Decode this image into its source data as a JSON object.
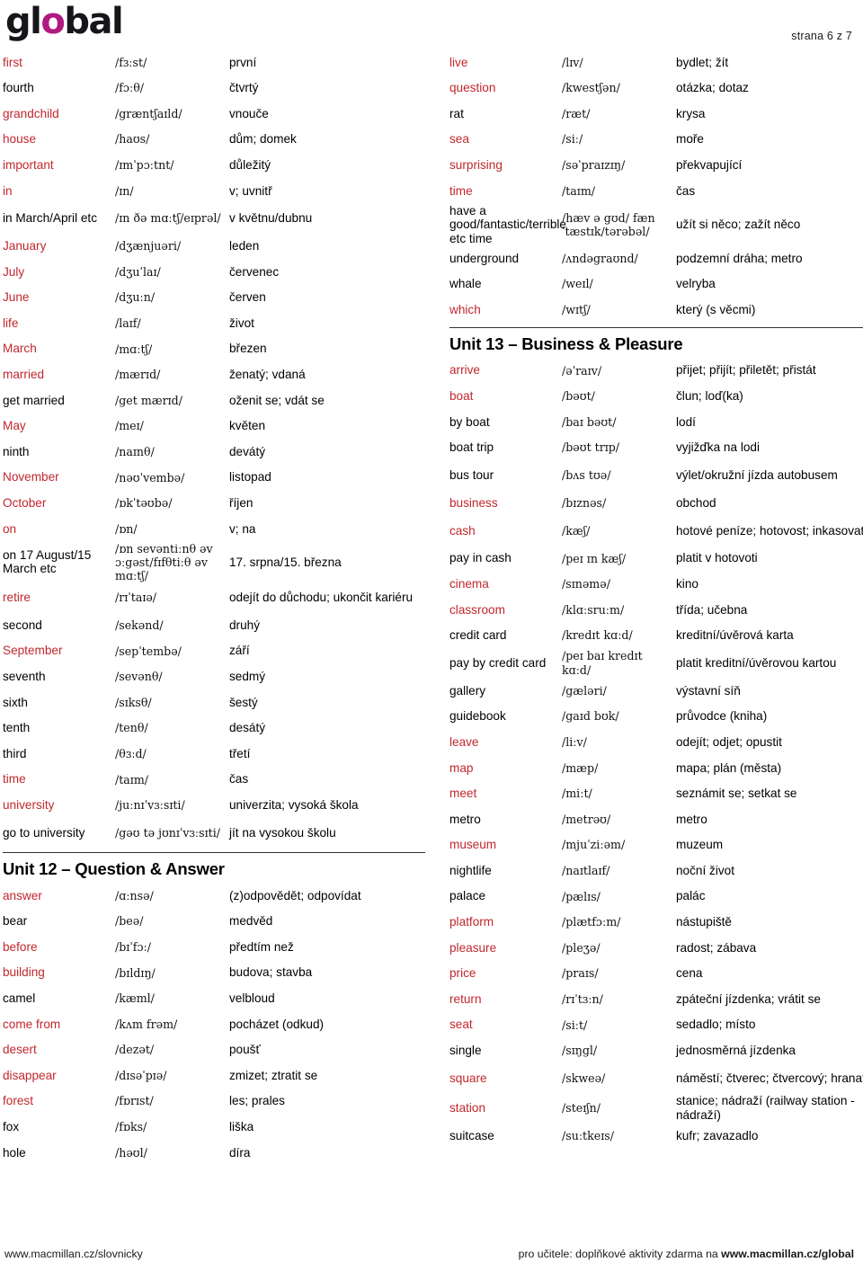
{
  "logo": {
    "part1": "gl",
    "part_o": "o",
    "part2": "bal"
  },
  "page_marker": "strana 6 z 7",
  "footer": {
    "left": "www.macmillan.cz/slovnicky",
    "right_prefix": "pro učitele: doplňkové aktivity zdarma na ",
    "right_bold": "www.macmillan.cz/global"
  },
  "colors": {
    "highlight": "#c1272d",
    "logo_accent": "#b0197f",
    "text": "#000000",
    "rule": "#333333"
  },
  "left_column": {
    "blocks": [
      {
        "type": "rows",
        "rows": [
          {
            "term": "first",
            "phon": "/fɜːst/",
            "cz": "první",
            "hl": true
          },
          {
            "term": "fourth",
            "phon": "/fɔːθ/",
            "cz": "čtvrtý",
            "hl": false
          },
          {
            "term": "grandchild",
            "phon": "/græntʃaɪld/",
            "cz": "vnouče",
            "hl": true
          },
          {
            "term": "house",
            "phon": "/haʊs/",
            "cz": "dům; domek",
            "hl": true
          },
          {
            "term": "important",
            "phon": "/ɪmˈpɔːtnt/",
            "cz": "důležitý",
            "hl": true
          },
          {
            "term": "in",
            "phon": "/ɪn/",
            "cz": "v; uvnitř",
            "hl": true
          },
          {
            "term": "in March/April etc",
            "phon": "/ɪn ðə mɑːtʃ/eɪprəl/",
            "cz": "v květnu/dubnu",
            "hl": false,
            "lines": 2
          },
          {
            "term": "January",
            "phon": "/dʒænjuəri/",
            "cz": "leden",
            "hl": true
          },
          {
            "term": "July",
            "phon": "/dʒuˈlaɪ/",
            "cz": "červenec",
            "hl": true
          },
          {
            "term": "June",
            "phon": "/dʒuːn/",
            "cz": "červen",
            "hl": true
          },
          {
            "term": "life",
            "phon": "/laɪf/",
            "cz": "život",
            "hl": true
          },
          {
            "term": "March",
            "phon": "/mɑːtʃ/",
            "cz": "březen",
            "hl": true
          },
          {
            "term": "married",
            "phon": "/mærɪd/",
            "cz": "ženatý; vdaná",
            "hl": true
          },
          {
            "term": "get married",
            "phon": "/get mærɪd/",
            "cz": "oženit se; vdát se",
            "hl": false
          },
          {
            "term": "May",
            "phon": "/meɪ/",
            "cz": "květen",
            "hl": true
          },
          {
            "term": "ninth",
            "phon": "/naɪnθ/",
            "cz": "devátý",
            "hl": false
          },
          {
            "term": "November",
            "phon": "/nəʊˈvembə/",
            "cz": "listopad",
            "hl": true
          },
          {
            "term": "October",
            "phon": "/ɒkˈtəʊbə/",
            "cz": "říjen",
            "hl": true
          },
          {
            "term": "on",
            "phon": "/ɒn/",
            "cz": "v; na",
            "hl": true
          },
          {
            "term": "on 17 August/15 March etc",
            "phon": "/ɒn sevəntiːnθ əv ɔːgəst/fɪfθtiːθ əv mɑːtʃ/",
            "cz": "17. srpna/15. března",
            "hl": false,
            "lines": 3
          },
          {
            "term": "retire",
            "phon": "/rɪˈtaɪə/",
            "cz": "odejít do důchodu; ukončit kariéru",
            "hl": true,
            "lines": 2
          },
          {
            "term": "second",
            "phon": "/sekənd/",
            "cz": "druhý",
            "hl": false
          },
          {
            "term": "September",
            "phon": "/sepˈtembə/",
            "cz": "září",
            "hl": true
          },
          {
            "term": "seventh",
            "phon": "/sevənθ/",
            "cz": "sedmý",
            "hl": false
          },
          {
            "term": "sixth",
            "phon": "/sɪksθ/",
            "cz": "šestý",
            "hl": false
          },
          {
            "term": "tenth",
            "phon": "/tenθ/",
            "cz": "desátý",
            "hl": false
          },
          {
            "term": "third",
            "phon": "/θɜːd/",
            "cz": "třetí",
            "hl": false
          },
          {
            "term": "time",
            "phon": "/taɪm/",
            "cz": "čas",
            "hl": true
          },
          {
            "term": "university",
            "phon": "/juːnɪˈvɜːsɪti/",
            "cz": "univerzita; vysoká škola",
            "hl": true
          },
          {
            "term": "go to university",
            "phon": "/gəʊ tə jʊnɪˈvɜːsɪti/",
            "cz": "jít na vysokou školu",
            "hl": false,
            "lines": 2
          }
        ]
      },
      {
        "type": "heading",
        "title": "Unit 12 – Question & Answer"
      },
      {
        "type": "rows",
        "rows": [
          {
            "term": "answer",
            "phon": "/ɑːnsə/",
            "cz": "(z)odpovědět; odpovídat",
            "hl": true
          },
          {
            "term": "bear",
            "phon": "/beə/",
            "cz": "medvěd",
            "hl": false
          },
          {
            "term": "before",
            "phon": "/bɪˈfɔː/",
            "cz": "předtím než",
            "hl": true
          },
          {
            "term": "building",
            "phon": "/bɪldɪŋ/",
            "cz": "budova; stavba",
            "hl": true
          },
          {
            "term": "camel",
            "phon": "/kæml/",
            "cz": "velbloud",
            "hl": false
          },
          {
            "term": "come from",
            "phon": "/kʌm frəm/",
            "cz": "pocházet (odkud)",
            "hl": true
          },
          {
            "term": "desert",
            "phon": "/dezət/",
            "cz": "poušť",
            "hl": true
          },
          {
            "term": "disappear",
            "phon": "/dɪsəˈpɪə/",
            "cz": "zmizet; ztratit se",
            "hl": true
          },
          {
            "term": "forest",
            "phon": "/fɒrɪst/",
            "cz": "les; prales",
            "hl": true
          },
          {
            "term": "fox",
            "phon": "/fɒks/",
            "cz": "liška",
            "hl": false
          },
          {
            "term": "hole",
            "phon": "/həʊl/",
            "cz": "díra",
            "hl": false
          }
        ]
      }
    ]
  },
  "right_column": {
    "blocks": [
      {
        "type": "rows",
        "rows": [
          {
            "term": "live",
            "phon": "/lɪv/",
            "cz": "bydlet; žít",
            "hl": true
          },
          {
            "term": "question",
            "phon": "/kwestʃən/",
            "cz": "otázka; dotaz",
            "hl": true
          },
          {
            "term": "rat",
            "phon": "/ræt/",
            "cz": "krysa",
            "hl": false
          },
          {
            "term": "sea",
            "phon": "/siː/",
            "cz": "moře",
            "hl": true
          },
          {
            "term": "surprising",
            "phon": "/səˈpraɪzɪŋ/",
            "cz": "překvapující",
            "hl": true
          },
          {
            "term": "time",
            "phon": "/taɪm/",
            "cz": "čas",
            "hl": true
          },
          {
            "term": "have a good/fantastic/terrible etc time",
            "phon": "/hæv ə gʊd/ fænˈtæstɪk/tərəbəl/",
            "cz": "užít si něco; zažít něco",
            "hl": false,
            "lines": 3
          },
          {
            "term": "underground",
            "phon": "/ʌndəgraʊnd/",
            "cz": "podzemní dráha; metro",
            "hl": false
          },
          {
            "term": "whale",
            "phon": "/weɪl/",
            "cz": "velryba",
            "hl": false
          },
          {
            "term": "which",
            "phon": "/wɪtʃ/",
            "cz": "který (s věcmi)",
            "hl": true
          }
        ]
      },
      {
        "type": "heading",
        "title": "Unit 13 – Business & Pleasure"
      },
      {
        "type": "rows",
        "rows": [
          {
            "term": "arrive",
            "phon": "/əˈraɪv/",
            "cz": "přijet; přijít; přiletět; přistát",
            "hl": true
          },
          {
            "term": "boat",
            "phon": "/bəʊt/",
            "cz": "člun; loď(ka)",
            "hl": true
          },
          {
            "term": "by boat",
            "phon": "/baɪ bəʊt/",
            "cz": "lodí",
            "hl": false
          },
          {
            "term": "boat trip",
            "phon": "/bəʊt trɪp/",
            "cz": "vyjižďka na lodi",
            "hl": false
          },
          {
            "term": "bus tour",
            "phon": "/bʌs tʊə/",
            "cz": "výlet/okružní jízda autobusem",
            "hl": false,
            "lines": 2
          },
          {
            "term": "business",
            "phon": "/bɪznəs/",
            "cz": "obchod",
            "hl": true
          },
          {
            "term": "cash",
            "phon": "/kæʃ/",
            "cz": "hotové peníze; hotovost; inkasovat",
            "hl": true,
            "lines": 2
          },
          {
            "term": "pay in cash",
            "phon": "/peɪ ɪn kæʃ/",
            "cz": "platit v hotovoti",
            "hl": false
          },
          {
            "term": "cinema",
            "phon": "/sɪnəmə/",
            "cz": "kino",
            "hl": true
          },
          {
            "term": "classroom",
            "phon": "/klɑːsruːm/",
            "cz": "třída; učebna",
            "hl": true
          },
          {
            "term": "credit card",
            "phon": "/kredɪt kɑːd/",
            "cz": "kreditní/úvěrová karta",
            "hl": false
          },
          {
            "term": "pay by credit card",
            "phon": "/peɪ baɪ kredɪt kɑːd/",
            "cz": "platit kreditní/úvěrovou kartou",
            "hl": false,
            "lines": 2
          },
          {
            "term": "gallery",
            "phon": "/gæləri/",
            "cz": "výstavní síň",
            "hl": false
          },
          {
            "term": "guidebook",
            "phon": "/gaɪd bʊk/",
            "cz": "průvodce (kniha)",
            "hl": false
          },
          {
            "term": "leave",
            "phon": "/liːv/",
            "cz": "odejít; odjet; opustit",
            "hl": true
          },
          {
            "term": "map",
            "phon": "/mæp/",
            "cz": "mapa; plán (města)",
            "hl": true
          },
          {
            "term": "meet",
            "phon": "/miːt/",
            "cz": "seznámit se; setkat se",
            "hl": true
          },
          {
            "term": "metro",
            "phon": "/metrəʊ/",
            "cz": "metro",
            "hl": false
          },
          {
            "term": "museum",
            "phon": "/mjuˈziːəm/",
            "cz": "muzeum",
            "hl": true
          },
          {
            "term": "nightlife",
            "phon": "/naɪtlaɪf/",
            "cz": "noční život",
            "hl": false
          },
          {
            "term": "palace",
            "phon": "/pælɪs/",
            "cz": "palác",
            "hl": false
          },
          {
            "term": "platform",
            "phon": "/plætfɔːm/",
            "cz": "nástupiště",
            "hl": true
          },
          {
            "term": "pleasure",
            "phon": "/pleʒə/",
            "cz": "radost; zábava",
            "hl": true
          },
          {
            "term": "price",
            "phon": "/praɪs/",
            "cz": "cena",
            "hl": true
          },
          {
            "term": "return",
            "phon": "/rɪˈtɜːn/",
            "cz": "zpáteční jízdenka; vrátit se",
            "hl": true
          },
          {
            "term": "seat",
            "phon": "/siːt/",
            "cz": "sedadlo; místo",
            "hl": true
          },
          {
            "term": "single",
            "phon": "/sɪŋgl/",
            "cz": "jednosměrná jízdenka",
            "hl": false
          },
          {
            "term": "square",
            "phon": "/skweə/",
            "cz": "náměstí; čtverec; čtvercový; hranatý",
            "hl": true,
            "lines": 2
          },
          {
            "term": "station",
            "phon": "/steɪʃn/",
            "cz": "stanice; nádraží (railway station - nádraží)",
            "hl": true,
            "lines": 2
          },
          {
            "term": "suitcase",
            "phon": "/suːtkeɪs/",
            "cz": "kufr; zavazadlo",
            "hl": false
          }
        ]
      }
    ]
  }
}
